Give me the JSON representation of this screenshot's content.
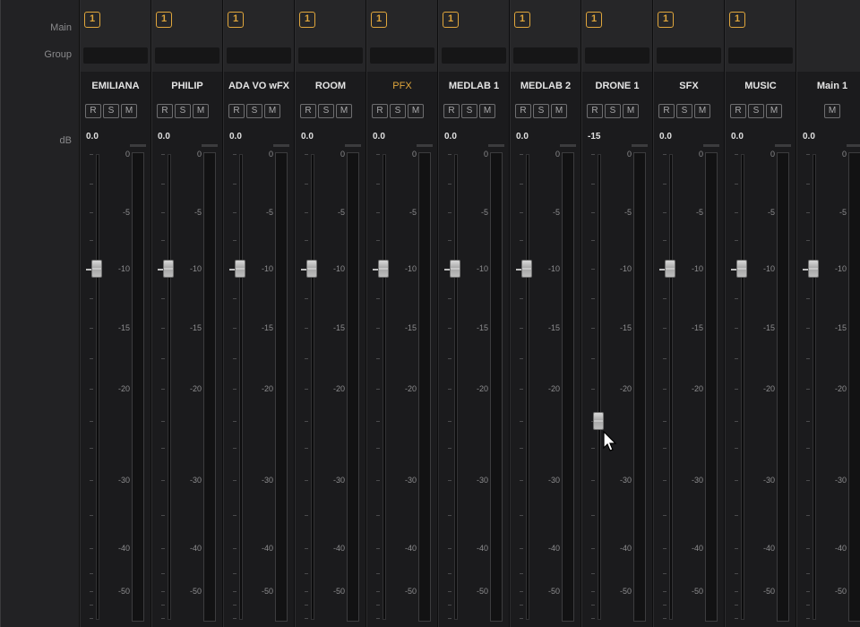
{
  "row_labels": {
    "main": "Main",
    "group": "Group",
    "db": "dB"
  },
  "strips": [
    {
      "name": "EMILIANA",
      "main": "1",
      "volume": "0.0",
      "buttons": [
        "R",
        "S",
        "M"
      ],
      "fader_db": -10,
      "active": false
    },
    {
      "name": "PHILIP",
      "main": "1",
      "volume": "0.0",
      "buttons": [
        "R",
        "S",
        "M"
      ],
      "fader_db": -10,
      "active": false
    },
    {
      "name": "ADA VO wFX",
      "main": "1",
      "volume": "0.0",
      "buttons": [
        "R",
        "S",
        "M"
      ],
      "fader_db": -10,
      "active": false
    },
    {
      "name": "ROOM",
      "main": "1",
      "volume": "0.0",
      "buttons": [
        "R",
        "S",
        "M"
      ],
      "fader_db": -10,
      "active": false
    },
    {
      "name": "PFX",
      "main": "1",
      "volume": "0.0",
      "buttons": [
        "R",
        "S",
        "M"
      ],
      "fader_db": -10,
      "active": true
    },
    {
      "name": "MEDLAB 1",
      "main": "1",
      "volume": "0.0",
      "buttons": [
        "R",
        "S",
        "M"
      ],
      "fader_db": -10,
      "active": false
    },
    {
      "name": "MEDLAB 2",
      "main": "1",
      "volume": "0.0",
      "buttons": [
        "R",
        "S",
        "M"
      ],
      "fader_db": -10,
      "active": false
    },
    {
      "name": "DRONE 1",
      "main": "1",
      "volume": "-15",
      "buttons": [
        "R",
        "S",
        "M"
      ],
      "fader_db": -25,
      "active": false
    },
    {
      "name": "SFX",
      "main": "1",
      "volume": "0.0",
      "buttons": [
        "R",
        "S",
        "M"
      ],
      "fader_db": -10,
      "active": false
    },
    {
      "name": "MUSIC",
      "main": "1",
      "volume": "0.0",
      "buttons": [
        "R",
        "S",
        "M"
      ],
      "fader_db": -10,
      "active": false
    },
    {
      "name": "Main 1",
      "main": "",
      "volume": "0.0",
      "buttons": [
        "M"
      ],
      "fader_db": -10,
      "active": false
    }
  ],
  "scale_labels": [
    "0",
    "-5",
    "-10",
    "-15",
    "-20",
    "-30",
    "-40",
    "-50"
  ],
  "colors": {
    "accent": "#e0a63c",
    "background": "#1b1b1d",
    "text": "#e4e4e4"
  }
}
